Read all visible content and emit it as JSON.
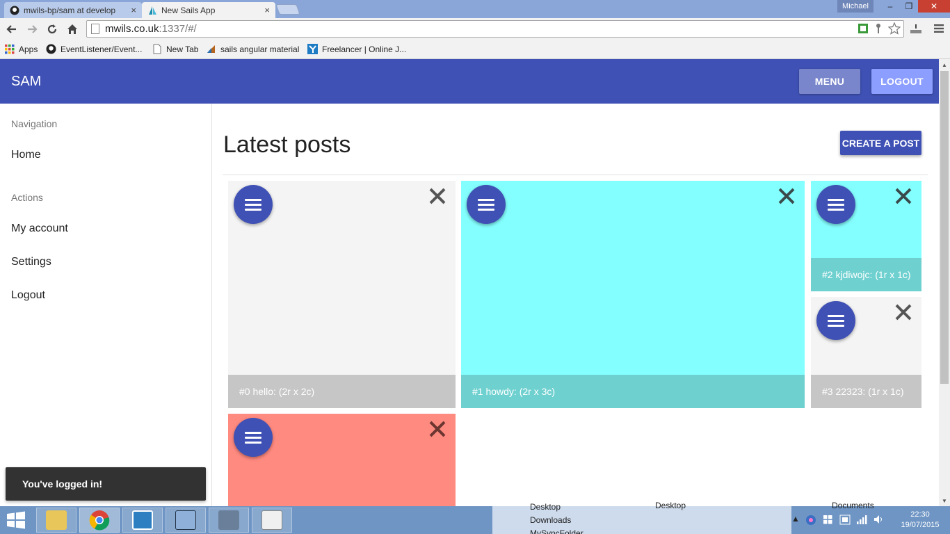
{
  "browser": {
    "tabs": [
      {
        "title": "mwils-bp/sam at develop",
        "close": "×"
      },
      {
        "title": "New Sails App",
        "close": "×"
      }
    ],
    "profile_name": "Michael",
    "window_controls": {
      "minimize": "‒",
      "restore": "❐",
      "close": "✕"
    },
    "url_host": "mwils.co.uk",
    "url_path": ":1337/#/",
    "nav_icons": {
      "back": "back-arrow-icon",
      "forward": "forward-arrow-icon",
      "reload": "reload-icon",
      "home": "home-icon"
    },
    "bookmarks": [
      {
        "label": "Apps",
        "icon": "apps-grid-icon"
      },
      {
        "label": "EventListener/Event...",
        "icon": "github-icon"
      },
      {
        "label": "New Tab",
        "icon": "page-icon"
      },
      {
        "label": "sails angular material",
        "icon": "sails-icon"
      },
      {
        "label": "Freelancer | Online J...",
        "icon": "freelancer-icon"
      }
    ]
  },
  "app": {
    "brand": "SAM",
    "menu_label": "MENU",
    "logout_label": "LOGOUT",
    "colors": {
      "primary": "#3f51b5",
      "menu_button": "#7986cb",
      "logout_button": "#8c9eff"
    }
  },
  "sidebar": {
    "navigation_header": "Navigation",
    "navigation_items": [
      "Home"
    ],
    "actions_header": "Actions",
    "action_items": [
      "My account",
      "Settings",
      "Logout"
    ]
  },
  "main": {
    "title": "Latest posts",
    "create_label": "CREATE A POST",
    "posts": [
      {
        "caption": "#0 hello: (2r x 2c)",
        "bg": "#f4f4f4",
        "footer_bg": "#c6c6c6",
        "x_color": "#555555"
      },
      {
        "caption": "#1 howdy: (2r x 3c)",
        "bg": "#84ffff",
        "footer_bg": "#6fd0d0",
        "x_color": "#3a4a4a"
      },
      {
        "caption": "#2 kjdiwojc: (1r x 1c)",
        "bg": "#84ffff",
        "footer_bg": "#6fd0d0",
        "x_color": "#3a4a4a"
      },
      {
        "caption": "#3 22323: (1r x 1c)",
        "bg": "#f4f4f4",
        "footer_bg": "#c6c6c6",
        "x_color": "#555555"
      },
      {
        "caption": "",
        "bg": "#ff8a80",
        "footer_bg": "",
        "x_color": "#6b3530"
      }
    ]
  },
  "toast": {
    "message": "You've logged in!"
  },
  "taskbar": {
    "background_items": [
      "Desktop",
      "Downloads",
      "MySyncFolder",
      "Desktop",
      "Documents"
    ],
    "clock_time": "22:30",
    "clock_date": "19/07/2015"
  }
}
